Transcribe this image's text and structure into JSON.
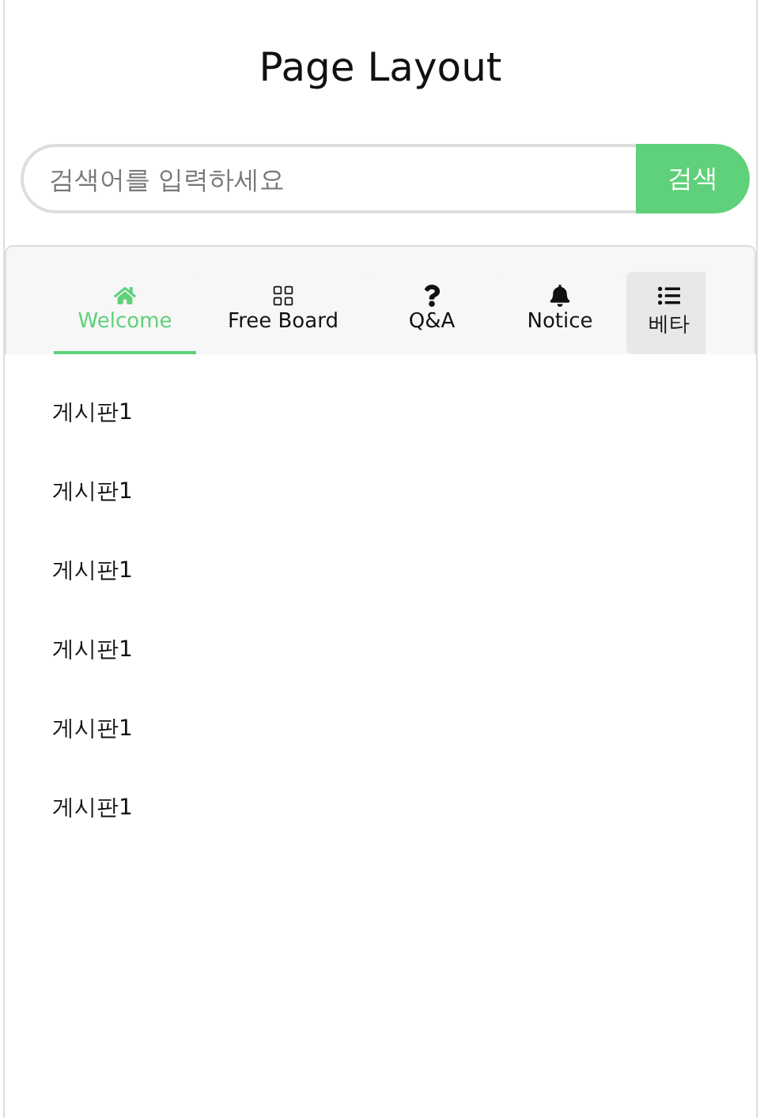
{
  "title": "Page Layout",
  "search": {
    "placeholder": "검색어를 입력하세요",
    "button": "검색"
  },
  "tabs": [
    {
      "label": "Welcome",
      "selected": true,
      "hovered": false
    },
    {
      "label": "Free Board",
      "selected": false,
      "hovered": false
    },
    {
      "label": "Q&A",
      "selected": false,
      "hovered": false
    },
    {
      "label": "Notice",
      "selected": false,
      "hovered": false
    },
    {
      "label": "베타",
      "selected": false,
      "hovered": true
    }
  ],
  "posts": [
    "게시판1",
    "게시판1",
    "게시판1",
    "게시판1",
    "게시판1",
    "게시판1"
  ]
}
